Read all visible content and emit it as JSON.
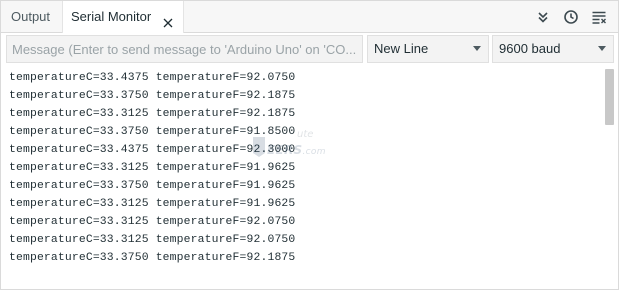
{
  "tabs": {
    "output_label": "Output",
    "serial_label": "Serial Monitor"
  },
  "toolbar": {
    "icons": [
      "chevron-double-down-icon",
      "clock-icon",
      "clear-output-icon"
    ]
  },
  "input": {
    "placeholder": "Message (Enter to send message to 'Arduino Uno' on 'CO...",
    "value": ""
  },
  "line_ending": {
    "selected": "New Line"
  },
  "baud_rate": {
    "selected": "9600 baud"
  },
  "output_lines": [
    "temperatureC=33.4375 temperatureF=92.0750",
    "temperatureC=33.3750 temperatureF=92.1875",
    "temperatureC=33.3125 temperatureF=92.1875",
    "temperatureC=33.3750 temperatureF=91.8500",
    "temperatureC=33.4375 temperatureF=92.3000",
    "temperatureC=33.3125 temperatureF=91.9625",
    "temperatureC=33.3750 temperatureF=91.9625",
    "temperatureC=33.3125 temperatureF=91.9625",
    "temperatureC=33.3125 temperatureF=92.0750",
    "temperatureC=33.3125 temperatureF=92.0750",
    "temperatureC=33.3750 temperatureF=92.1875"
  ],
  "watermark": {
    "top": "ute",
    "main": "EERS",
    "suffix": ".com"
  },
  "colors": {
    "tabbar_bg": "#f7f7f7",
    "field_bg": "#f3f3f3",
    "text": "#1f2d33",
    "scrollbar": "#c8c8c8"
  }
}
